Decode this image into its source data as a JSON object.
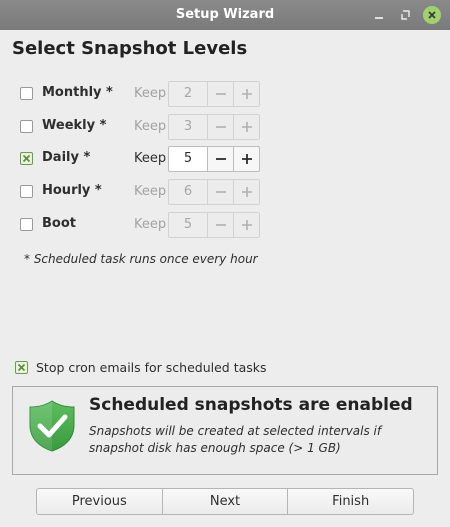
{
  "window": {
    "title": "Setup Wizard"
  },
  "heading": "Select Snapshot Levels",
  "levels": [
    {
      "label": "Monthly *",
      "checked": false,
      "keep_label": "Keep",
      "value": "2",
      "enabled": false
    },
    {
      "label": "Weekly *",
      "checked": false,
      "keep_label": "Keep",
      "value": "3",
      "enabled": false
    },
    {
      "label": "Daily *",
      "checked": true,
      "keep_label": "Keep",
      "value": "5",
      "enabled": true
    },
    {
      "label": "Hourly *",
      "checked": false,
      "keep_label": "Keep",
      "value": "6",
      "enabled": false
    },
    {
      "label": "Boot",
      "checked": false,
      "keep_label": "Keep",
      "value": "5",
      "enabled": false
    }
  ],
  "note": "* Scheduled task runs once every hour",
  "cron": {
    "label": "Stop cron emails for scheduled tasks",
    "checked": true
  },
  "status": {
    "title": "Scheduled snapshots are enabled",
    "message": "Snapshots will be created at selected intervals if snapshot disk has enough space (> 1 GB)",
    "icon": "shield-check-icon",
    "color": "#4caf50"
  },
  "nav": {
    "previous": "Previous",
    "next": "Next",
    "finish": "Finish"
  }
}
